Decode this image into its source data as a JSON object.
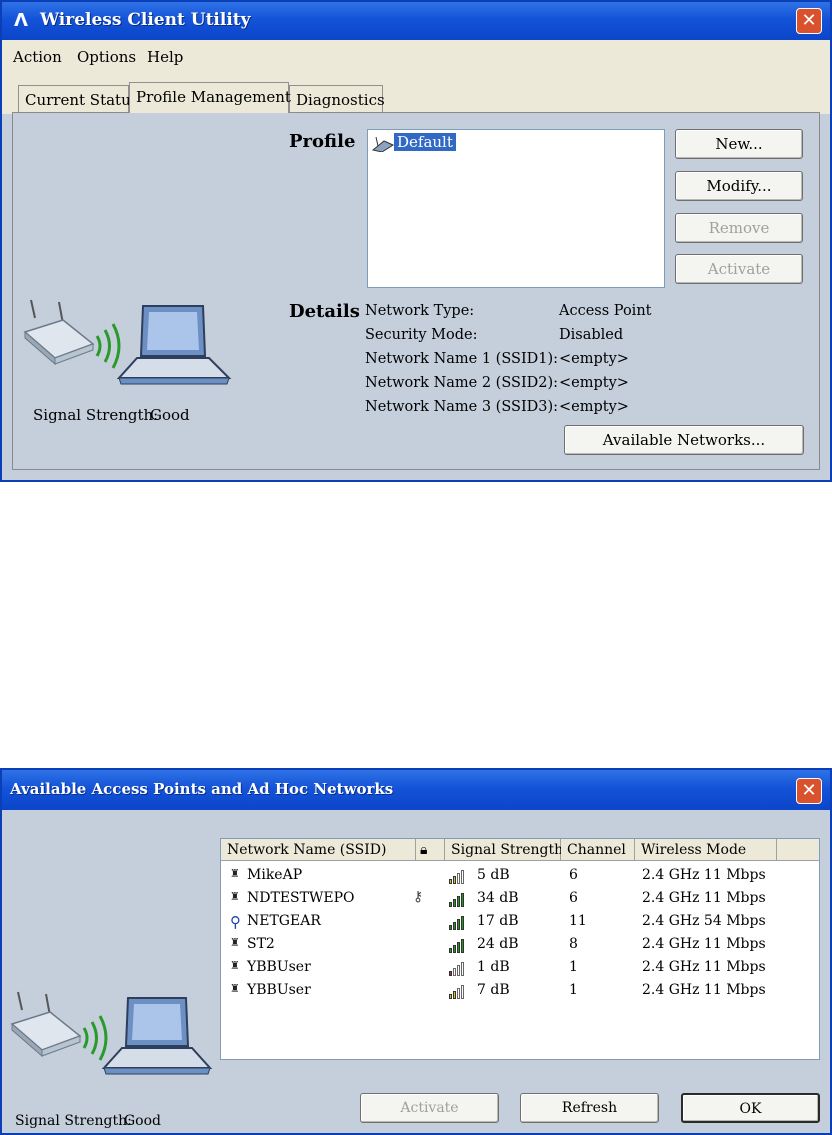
{
  "wcu": {
    "title": "Wireless Client Utility",
    "menu": [
      "Action",
      "Options",
      "Help"
    ],
    "tabs": [
      "Current Status",
      "Profile Management",
      "Diagnostics"
    ],
    "profile_heading": "Profile",
    "profiles": [
      "Default"
    ],
    "buttons": {
      "new": "New...",
      "modify": "Modify...",
      "remove": "Remove",
      "activate": "Activate",
      "available": "Available Networks..."
    },
    "details_heading": "Details",
    "details": [
      {
        "label": "Network Type:",
        "value": "Access Point"
      },
      {
        "label": "Security Mode:",
        "value": "Disabled"
      },
      {
        "label": "Network Name 1 (SSID1):",
        "value": "<empty>"
      },
      {
        "label": "Network Name 2 (SSID2):",
        "value": "<empty>"
      },
      {
        "label": "Network Name 3 (SSID3):",
        "value": "<empty>"
      }
    ],
    "signal_label": "Signal Strength:",
    "signal_value": "Good"
  },
  "aap": {
    "title": "Available Access Points and Ad Hoc Networks",
    "columns": [
      "Network Name (SSID)",
      "",
      "Signal Strength",
      "Channel",
      "Wireless Mode"
    ],
    "rows": [
      {
        "ssid": "MikeAP",
        "secured": false,
        "signal": "5 dB",
        "channel": "6",
        "mode": "2.4 GHz 11 Mbps",
        "level": 2,
        "color": "#d4c21a",
        "icon": "infrastructure-icon"
      },
      {
        "ssid": "NDTESTWEPO",
        "secured": true,
        "signal": "34 dB",
        "channel": "6",
        "mode": "2.4 GHz 11 Mbps",
        "level": 4,
        "color": "#1f9a1f",
        "icon": "infrastructure-icon"
      },
      {
        "ssid": "NETGEAR",
        "secured": false,
        "signal": "17 dB",
        "channel": "11",
        "mode": "2.4 GHz 54 Mbps",
        "level": 4,
        "color": "#1f9a1f",
        "icon": "ad-hoc-icon"
      },
      {
        "ssid": "ST2",
        "secured": false,
        "signal": "24 dB",
        "channel": "8",
        "mode": "2.4 GHz 11 Mbps",
        "level": 4,
        "color": "#1f9a1f",
        "icon": "infrastructure-icon"
      },
      {
        "ssid": "YBBUser",
        "secured": false,
        "signal": "1 dB",
        "channel": "1",
        "mode": "2.4 GHz 11 Mbps",
        "level": 1,
        "color": "#c81e1e",
        "icon": "infrastructure-icon"
      },
      {
        "ssid": "YBBUser",
        "secured": false,
        "signal": "7 dB",
        "channel": "1",
        "mode": "2.4 GHz 11 Mbps",
        "level": 2,
        "color": "#d4c21a",
        "icon": "infrastructure-icon"
      }
    ],
    "buttons": {
      "activate": "Activate",
      "refresh": "Refresh",
      "ok": "OK"
    },
    "signal_label": "Signal Strength:",
    "signal_value": "Good"
  }
}
